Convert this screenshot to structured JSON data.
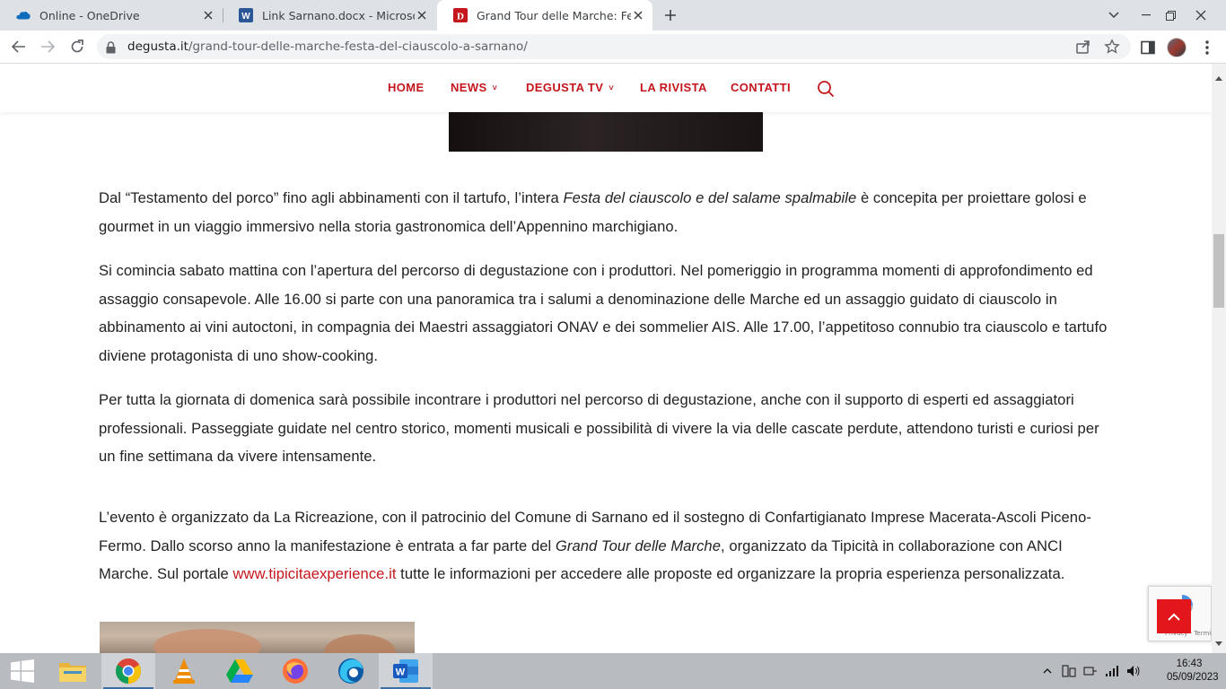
{
  "browser": {
    "tabs": [
      {
        "title": "Online - OneDrive",
        "icon": "onedrive-icon"
      },
      {
        "title": "Link Sarnano.docx - Microsoft W",
        "icon": "word-icon"
      },
      {
        "title": "Grand Tour delle Marche: Festa d",
        "icon": "degusta-icon",
        "active": true
      }
    ],
    "url_domain": "degusta.it",
    "url_path": "/grand-tour-delle-marche-festa-del-ciauscolo-a-sarnano/"
  },
  "site_nav": {
    "items": [
      "HOME",
      "NEWS",
      "DEGUSTA TV",
      "LA RIVISTA",
      "CONTATTI"
    ],
    "dropdown_caret": "˅"
  },
  "article": {
    "p1_before": "Dal “Testamento del porco” fino agli abbinamenti con il tartufo, l’intera ",
    "p1_em": "Festa del ciauscolo e del salame spalmabile",
    "p1_after": " è concepita per proiettare golosi e gourmet in un viaggio immersivo nella storia gastronomica dell’Appennino marchigiano.",
    "p2": "Si comincia sabato mattina con l’apertura del percorso di degustazione con i produttori. Nel pomeriggio in programma momenti di approfondimento ed assaggio consapevole. Alle 16.00 si parte con una panoramica tra i salumi a denominazione delle Marche ed un assaggio guidato di ciauscolo in abbinamento ai vini autoctoni, in compagnia dei Maestri assaggiatori ONAV e dei sommelier AIS. Alle 17.00, l’appetitoso connubio tra ciauscolo e tartufo diviene protagonista di uno show-cooking.",
    "p3": "Per tutta la giornata di domenica sarà possibile incontrare i produttori nel percorso di degustazione, anche con il supporto di esperti ed assaggiatori professionali. Passeggiate guidate nel centro storico, momenti musicali e possibilità di vivere la via delle cascate perdute, attendono turisti e curiosi per un fine settimana da vivere intensamente.",
    "p4_a": "L’evento è organizzato da La Ricreazione, con il patrocinio del Comune di Sarnano ed il sostegno di Confartigianato Imprese Macerata-Ascoli Piceno-Fermo. Dallo scorso anno la manifestazione è entrata a far parte del ",
    "p4_em": "Grand Tour delle Marche",
    "p4_b": ", organizzato da Tipicità in collaborazione con ANCI Marche. Sul portale ",
    "p4_link": "www.tipicitaexperience.it",
    "p4_c": " tutte le informazioni per accedere alle proposte ed organizzare la propria esperienza personalizzata."
  },
  "recaptcha": {
    "label": "Privacy - Termini"
  },
  "taskbar": {
    "apps": [
      "windows-start-icon",
      "file-explorer-icon",
      "chrome-icon",
      "vlc-icon",
      "google-drive-icon",
      "firefox-icon",
      "edge-icon",
      "word-icon"
    ],
    "time": "16:43",
    "date": "05/09/2023"
  },
  "colors": {
    "brand_red": "#c4161c",
    "chrome_tabstrip": "#dee1e6",
    "taskbar": "#b8bcc1"
  }
}
